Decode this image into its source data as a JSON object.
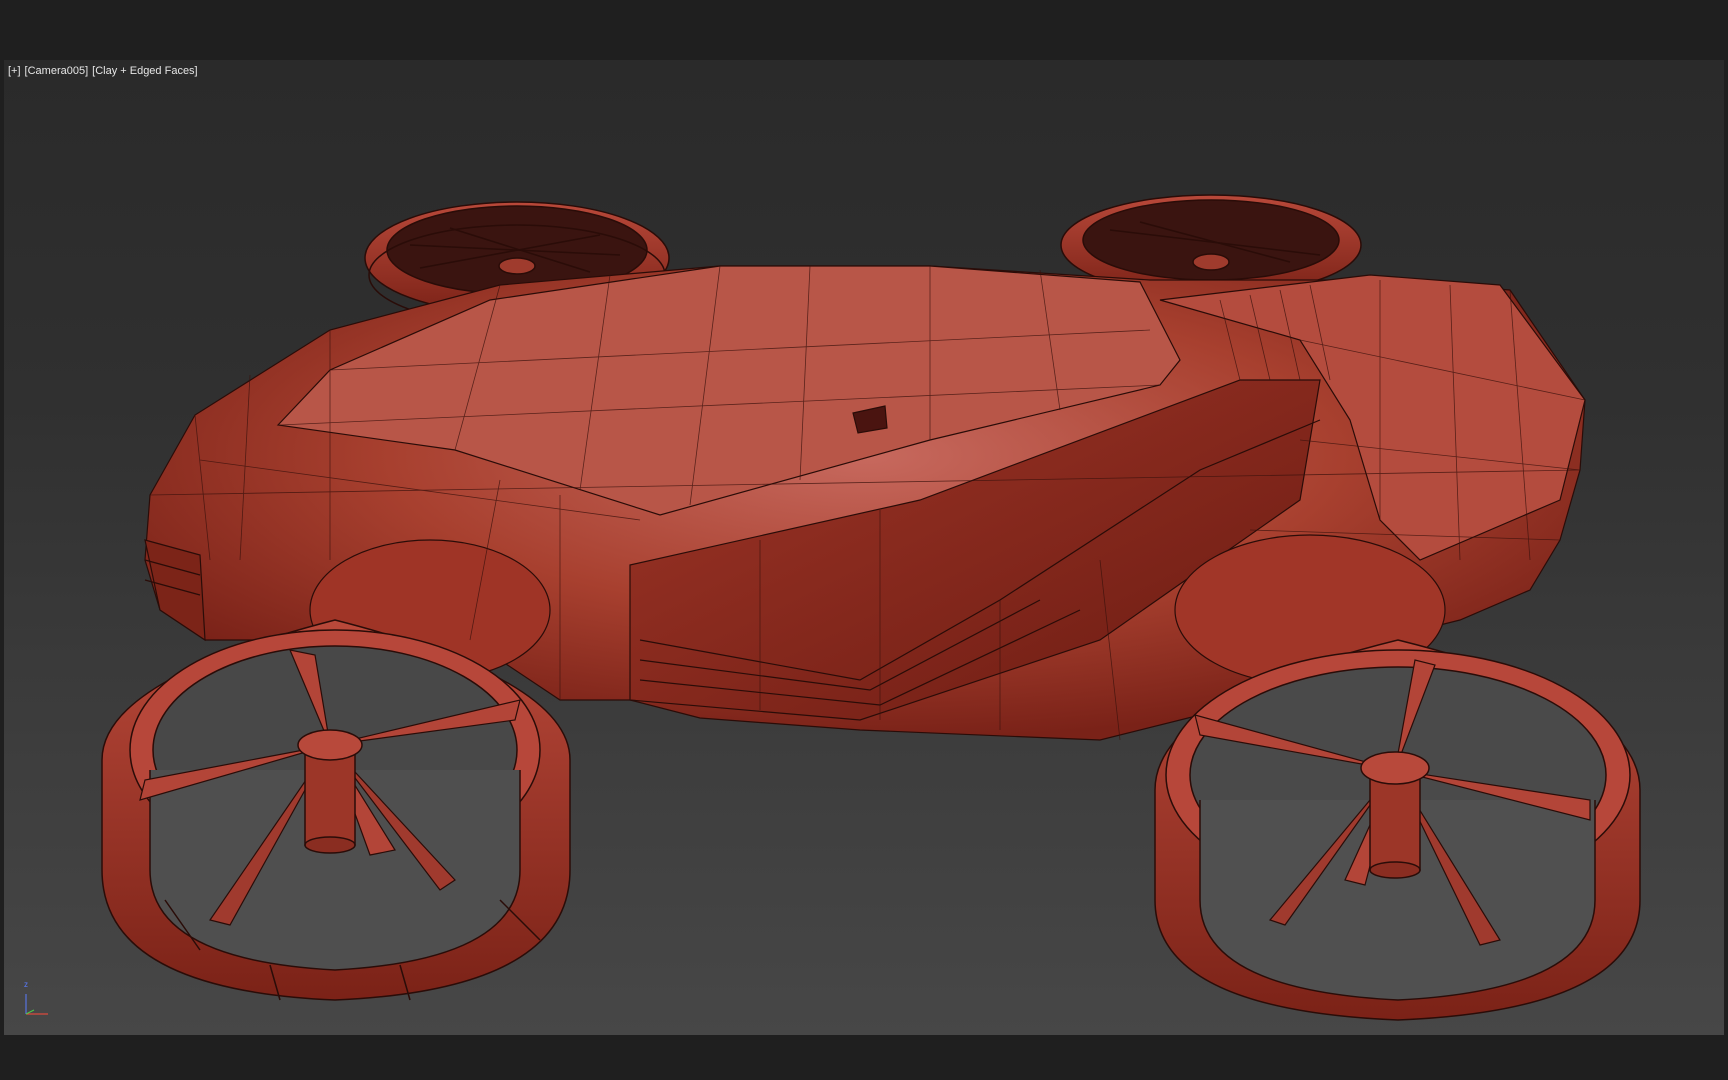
{
  "viewport": {
    "labels": {
      "plus": "[+]",
      "camera": "[Camera005]",
      "shading": "[Clay + Edged Faces]"
    },
    "axis_label": "z"
  },
  "colors": {
    "clay": "#b3483c",
    "clay_dark": "#6f1d16",
    "wire": "#2a0c08",
    "background_top": "#2a2a2a",
    "background_bottom": "#474747"
  },
  "icons": [
    "view-axis-gizmo-icon"
  ]
}
